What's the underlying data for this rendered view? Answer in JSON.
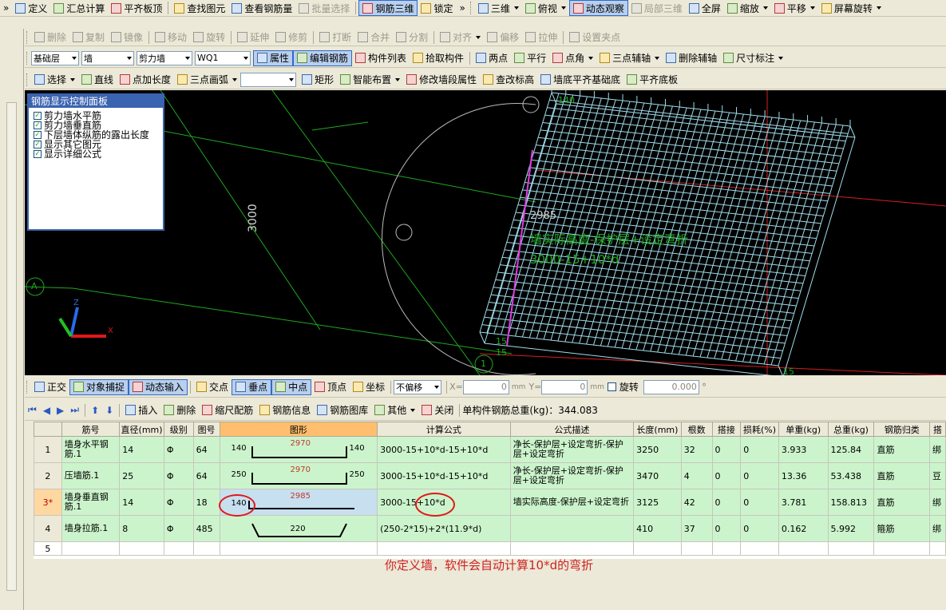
{
  "toolbar1": {
    "items": [
      {
        "label": "定义",
        "icon": "define-icon"
      },
      {
        "label": "汇总计算",
        "icon": "sigma-icon"
      },
      {
        "label": "平齐板顶",
        "icon": "align-top-icon"
      },
      {
        "label": "查找图元",
        "icon": "find-icon"
      },
      {
        "label": "查看钢筋量",
        "icon": "view-rebar-icon"
      },
      {
        "label": "批量选择",
        "icon": "batch-select-icon",
        "disabled": true
      },
      {
        "label": "钢筋三维",
        "icon": "rebar-3d-icon",
        "active": true
      },
      {
        "label": "锁定",
        "icon": "lock-icon"
      }
    ],
    "right_items": [
      {
        "label": "三维",
        "icon": "cube-icon"
      },
      {
        "label": "俯视",
        "icon": "top-view-icon"
      },
      {
        "label": "动态观察",
        "icon": "orbit-icon",
        "active": true
      },
      {
        "label": "局部三维",
        "icon": "local-3d-icon",
        "disabled": true
      },
      {
        "label": "全屏",
        "icon": "fullscreen-icon"
      },
      {
        "label": "缩放",
        "icon": "zoom-icon"
      },
      {
        "label": "平移",
        "icon": "pan-icon"
      },
      {
        "label": "屏幕旋转",
        "icon": "screen-rotate-icon"
      }
    ]
  },
  "toolbar2": {
    "items": [
      {
        "label": "删除",
        "icon": "delete-icon"
      },
      {
        "label": "复制",
        "icon": "copy-icon"
      },
      {
        "label": "镜像",
        "icon": "mirror-icon"
      },
      {
        "label": "移动",
        "icon": "move-icon"
      },
      {
        "label": "旋转",
        "icon": "rotate-icon"
      },
      {
        "label": "延伸",
        "icon": "extend-icon"
      },
      {
        "label": "修剪",
        "icon": "trim-icon"
      },
      {
        "label": "打断",
        "icon": "break-icon"
      },
      {
        "label": "合并",
        "icon": "merge-icon"
      },
      {
        "label": "分割",
        "icon": "split-icon"
      },
      {
        "label": "对齐",
        "icon": "align-icon"
      },
      {
        "label": "偏移",
        "icon": "offset-icon"
      },
      {
        "label": "拉伸",
        "icon": "stretch-icon"
      },
      {
        "label": "设置夹点",
        "icon": "grip-point-icon"
      }
    ]
  },
  "toolbar3": {
    "floor": "基础层",
    "category": "墙",
    "type": "剪力墙",
    "element": "WQ1",
    "items": [
      {
        "label": "属性",
        "icon": "property-icon",
        "active": true
      },
      {
        "label": "编辑钢筋",
        "icon": "edit-rebar-icon",
        "active": true
      },
      {
        "label": "构件列表",
        "icon": "list-icon"
      },
      {
        "label": "拾取构件",
        "icon": "pick-icon"
      },
      {
        "label": "两点",
        "icon": "two-point-icon"
      },
      {
        "label": "平行",
        "icon": "parallel-icon"
      },
      {
        "label": "点角",
        "icon": "point-angle-icon"
      },
      {
        "label": "三点辅轴",
        "icon": "three-point-axis-icon"
      },
      {
        "label": "删除辅轴",
        "icon": "delete-axis-icon"
      },
      {
        "label": "尺寸标注",
        "icon": "dimension-icon"
      }
    ]
  },
  "toolbar4": {
    "items": [
      {
        "label": "选择",
        "icon": "select-arrow-icon"
      },
      {
        "label": "直线",
        "icon": "line-icon"
      },
      {
        "label": "点加长度",
        "icon": "point-length-icon"
      },
      {
        "label": "三点画弧",
        "icon": "arc-icon"
      },
      {
        "label": "矩形",
        "icon": "rectangle-icon"
      },
      {
        "label": "智能布置",
        "icon": "smart-layout-icon"
      },
      {
        "label": "修改墙段属性",
        "icon": "wall-prop-icon"
      },
      {
        "label": "查改标高",
        "icon": "elevation-icon"
      },
      {
        "label": "墙底平齐基础底",
        "icon": "wall-bottom-icon"
      },
      {
        "label": "平齐底板",
        "icon": "align-bottom-icon"
      }
    ]
  },
  "panel": {
    "title": "钢筋显示控制面板",
    "options": [
      "剪力墙水平筋",
      "剪力墙垂直筋",
      "下层墙体纵筋的露出长度",
      "显示其它图元",
      "显示详细公式"
    ]
  },
  "viewport": {
    "dim_3000": "3000",
    "axis_a": "A",
    "axis_1": "1",
    "label_2985": "2985",
    "formula_text": "墙实际高度-保护层+设定弯折",
    "formula_expr": "3000-15+10*d",
    "label_15a": "15",
    "label_15b": "15",
    "label_15c": "15",
    "label_140": "140"
  },
  "snapbar": {
    "items": [
      {
        "label": "正交",
        "icon": "ortho-icon"
      },
      {
        "label": "对象捕捉",
        "icon": "osnap-icon",
        "active": true
      },
      {
        "label": "动态输入",
        "icon": "dynamic-input-icon",
        "active": true
      },
      {
        "label": "交点",
        "icon": "intersection-icon"
      },
      {
        "label": "垂点",
        "icon": "perpendicular-icon",
        "active": true
      },
      {
        "label": "中点",
        "icon": "midpoint-icon",
        "active": true
      },
      {
        "label": "顶点",
        "icon": "vertex-icon"
      },
      {
        "label": "坐标",
        "icon": "coordinate-icon"
      }
    ],
    "offset_mode": "不偏移",
    "x_label": "X=",
    "x_value": "0",
    "y_label": "Y=",
    "y_value": "0",
    "unit": "mm",
    "rotate_label": "旋转",
    "rotate_value": "0.000",
    "degree": "°"
  },
  "gridbar": {
    "items": [
      {
        "label": "插入",
        "icon": "insert-icon"
      },
      {
        "label": "删除",
        "icon": "delete-row-icon"
      },
      {
        "label": "缩尺配筋",
        "icon": "scale-rebar-icon"
      },
      {
        "label": "钢筋信息",
        "icon": "rebar-info-icon"
      },
      {
        "label": "钢筋图库",
        "icon": "rebar-library-icon"
      },
      {
        "label": "其他",
        "icon": "other-icon"
      },
      {
        "label": "关闭",
        "icon": "close-icon"
      }
    ],
    "total_weight_label": "单构件钢筋总重(kg)：",
    "total_weight": "344.083"
  },
  "table": {
    "columns": [
      "筋号",
      "直径(mm)",
      "级别",
      "图号",
      "图形",
      "计算公式",
      "公式描述",
      "长度(mm)",
      "根数",
      "搭接",
      "损耗(%)",
      "单重(kg)",
      "总重(kg)",
      "钢筋归类",
      "搭"
    ],
    "rows": [
      {
        "no": "1",
        "name": "墙身水平钢筋.1",
        "dia": "14",
        "grade": "Φ",
        "fig": "64",
        "shape_left": "140",
        "shape_mid": "2970",
        "shape_right": "140",
        "formula": "3000-15+10*d-15+10*d",
        "desc": "净长-保护层+设定弯折-保护层+设定弯折",
        "length": "3250",
        "count": "32",
        "lap": "0",
        "loss": "0",
        "unit_w": "3.933",
        "total_w": "125.84",
        "cat": "直筋",
        "extra": "绑"
      },
      {
        "no": "2",
        "name": "压墙筋.1",
        "dia": "25",
        "grade": "Φ",
        "fig": "64",
        "shape_left": "250",
        "shape_mid": "2970",
        "shape_right": "250",
        "formula": "3000-15+10*d-15+10*d",
        "desc": "净长-保护层+设定弯折-保护层+设定弯折",
        "length": "3470",
        "count": "4",
        "lap": "0",
        "loss": "0",
        "unit_w": "13.36",
        "total_w": "53.438",
        "cat": "直筋",
        "extra": "豆"
      },
      {
        "no": "3*",
        "name": "墙身垂直钢筋.1",
        "dia": "14",
        "grade": "Φ",
        "fig": "18",
        "shape_left": "140",
        "shape_mid": "2985",
        "shape_right": "",
        "formula": "3000-15+10*d",
        "desc": "墙实际高度-保护层+设定弯折",
        "length": "3125",
        "count": "42",
        "lap": "0",
        "loss": "0",
        "unit_w": "3.781",
        "total_w": "158.813",
        "cat": "直筋",
        "extra": "绑"
      },
      {
        "no": "4",
        "name": "墙身拉筋.1",
        "dia": "8",
        "grade": "Φ",
        "fig": "485",
        "shape_left": "",
        "shape_mid": "220",
        "shape_right": "",
        "formula": "(250-2*15)+2*(11.9*d)",
        "desc": "",
        "length": "410",
        "count": "37",
        "lap": "0",
        "loss": "0",
        "unit_w": "0.162",
        "total_w": "5.992",
        "cat": "箍筋",
        "extra": "绑"
      },
      {
        "no": "5",
        "name": "",
        "dia": "",
        "grade": "",
        "fig": "",
        "shape_left": "",
        "shape_mid": "",
        "shape_right": "",
        "formula": "",
        "desc": "",
        "length": "",
        "count": "",
        "lap": "",
        "loss": "",
        "unit_w": "",
        "total_w": "",
        "cat": "",
        "extra": ""
      }
    ]
  },
  "annotation": "你定义墙，软件会自动计算10*d的弯折",
  "colors": {
    "accent": "#316ac5",
    "viewport_bg": "#000000",
    "grid_line": "#1fa81f",
    "axis_red": "#d81e1e",
    "rebar_cyan": "#9fdcec",
    "row_green": "#ccf4cc",
    "note_red": "#d02222"
  }
}
